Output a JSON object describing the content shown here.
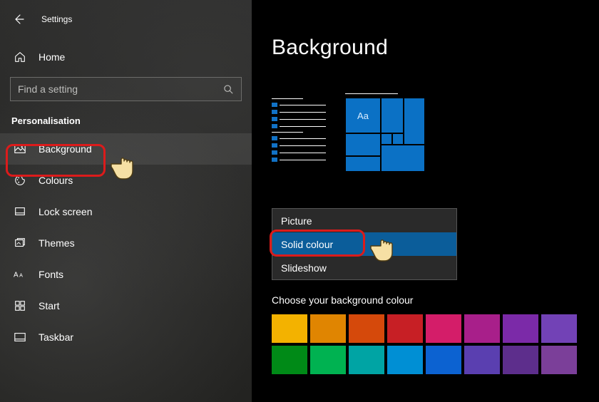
{
  "header": {
    "title": "Settings"
  },
  "sidebar": {
    "home": "Home",
    "search_placeholder": "Find a setting",
    "section": "Personalisation",
    "items": [
      {
        "key": "background",
        "label": "Background"
      },
      {
        "key": "colours",
        "label": "Colours"
      },
      {
        "key": "lockscreen",
        "label": "Lock screen"
      },
      {
        "key": "themes",
        "label": "Themes"
      },
      {
        "key": "fonts",
        "label": "Fonts"
      },
      {
        "key": "start",
        "label": "Start"
      },
      {
        "key": "taskbar",
        "label": "Taskbar"
      }
    ]
  },
  "main": {
    "title": "Background",
    "preview_sample_text": "Aa",
    "dropdown": {
      "options": [
        {
          "key": "picture",
          "label": "Picture"
        },
        {
          "key": "solid",
          "label": "Solid colour"
        },
        {
          "key": "slideshow",
          "label": "Slideshow"
        }
      ],
      "selected": "solid"
    },
    "colour_label": "Choose your background colour",
    "colours_row1": [
      "#f3b200",
      "#e08501",
      "#d5490b",
      "#c71f25",
      "#d41d69",
      "#a81f8a",
      "#7b2aa8",
      "#7242b6"
    ],
    "colours_row2": [
      "#008a17",
      "#00b251",
      "#00a4a4",
      "#008fd4",
      "#0c62d1",
      "#5a3fb0",
      "#5d2e8c",
      "#7b3f99"
    ]
  },
  "annotations": {
    "highlight_sidebar_item": "background",
    "highlight_dropdown_item": "solid"
  }
}
